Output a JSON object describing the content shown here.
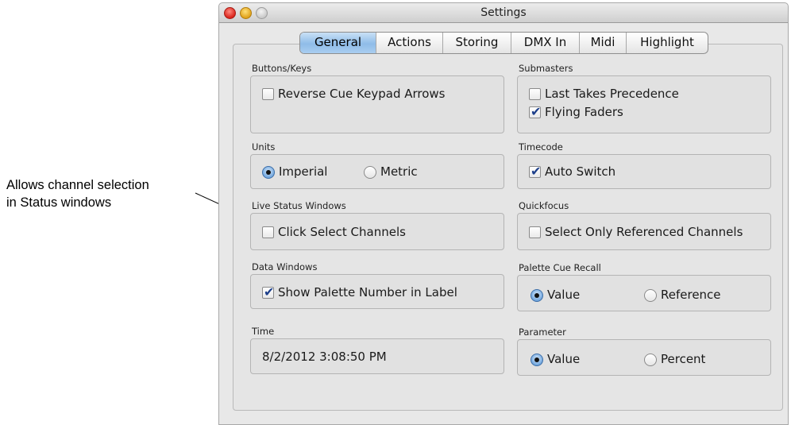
{
  "annotation": {
    "line1": "Allows channel selection",
    "line2": "in Status windows"
  },
  "window": {
    "title": "Settings"
  },
  "tabs": [
    {
      "label": "General",
      "active": true
    },
    {
      "label": "Actions",
      "active": false
    },
    {
      "label": "Storing",
      "active": false
    },
    {
      "label": "DMX In",
      "active": false
    },
    {
      "label": "Midi",
      "active": false
    },
    {
      "label": "Highlight",
      "active": false
    }
  ],
  "groups": {
    "buttons_keys": {
      "label": "Buttons/Keys",
      "reverse_cue": {
        "label": "Reverse Cue Keypad Arrows",
        "checked": false
      }
    },
    "submasters": {
      "label": "Submasters",
      "last_takes": {
        "label": "Last Takes Precedence",
        "checked": false
      },
      "flying_faders": {
        "label": "Flying Faders",
        "checked": true
      }
    },
    "units": {
      "label": "Units",
      "imperial": {
        "label": "Imperial",
        "selected": true
      },
      "metric": {
        "label": "Metric",
        "selected": false
      }
    },
    "timecode": {
      "label": "Timecode",
      "auto_switch": {
        "label": "Auto Switch",
        "checked": true
      }
    },
    "live_status": {
      "label": "Live Status Windows",
      "click_select": {
        "label": "Click Select Channels",
        "checked": false
      }
    },
    "quickfocus": {
      "label": "Quickfocus",
      "select_only": {
        "label": "Select Only Referenced Channels",
        "checked": false
      }
    },
    "data_windows": {
      "label": "Data Windows",
      "show_palette": {
        "label": "Show Palette Number in Label",
        "checked": true
      }
    },
    "palette_cue_recall": {
      "label": "Palette Cue Recall",
      "value": {
        "label": "Value",
        "selected": true
      },
      "reference": {
        "label": "Reference",
        "selected": false
      }
    },
    "time": {
      "label": "Time",
      "value": "8/2/2012 3:08:50 PM"
    },
    "parameter": {
      "label": "Parameter",
      "value": {
        "label": "Value",
        "selected": true
      },
      "percent": {
        "label": "Percent",
        "selected": false
      }
    }
  }
}
